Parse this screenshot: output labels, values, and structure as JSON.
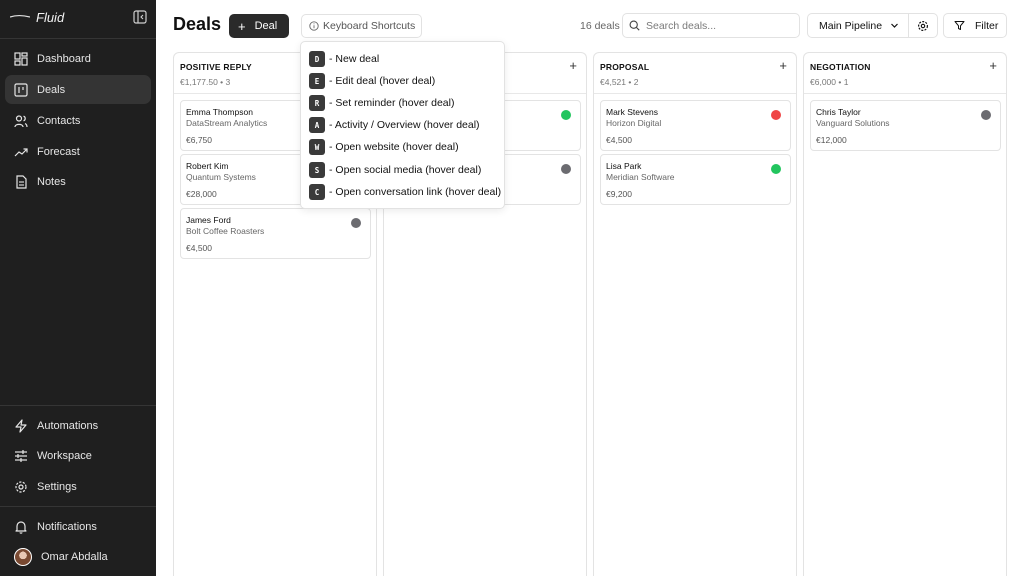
{
  "app": {
    "name": "Fluid"
  },
  "sidebar": {
    "nav": [
      {
        "label": "Dashboard",
        "icon": "dashboard-icon",
        "active": false
      },
      {
        "label": "Deals",
        "icon": "deals-icon",
        "active": true
      },
      {
        "label": "Contacts",
        "icon": "contacts-icon",
        "active": false
      },
      {
        "label": "Forecast",
        "icon": "trending-up-icon",
        "active": false
      },
      {
        "label": "Notes",
        "icon": "notes-icon",
        "active": false
      }
    ],
    "bottom_nav": [
      {
        "label": "Automations",
        "icon": "zap-icon"
      },
      {
        "label": "Workspace",
        "icon": "sliders-icon"
      },
      {
        "label": "Settings",
        "icon": "gear-icon"
      }
    ],
    "notifications": {
      "label": "Notifications",
      "icon": "bell-icon"
    },
    "user": {
      "name": "Omar Abdalla"
    }
  },
  "header": {
    "title": "Deals",
    "add_button_label": "Deal",
    "shortcuts_button_label": "Keyboard Shortcuts",
    "deal_count": "16 deals",
    "search_placeholder": "Search deals...",
    "pipeline": "Main Pipeline",
    "filter_label": "Filter"
  },
  "shortcuts": [
    {
      "key": "D",
      "label": "- New deal"
    },
    {
      "key": "E",
      "label": "- Edit deal (hover deal)"
    },
    {
      "key": "R",
      "label": "- Set reminder (hover deal)"
    },
    {
      "key": "A",
      "label": "- Activity / Overview (hover deal)"
    },
    {
      "key": "W",
      "label": "- Open website (hover deal)"
    },
    {
      "key": "S",
      "label": "- Open social media (hover deal)"
    },
    {
      "key": "C",
      "label": "- Open conversation link (hover deal)"
    }
  ],
  "columns": [
    {
      "title": "POSITIVE REPLY",
      "summary": "€1,177.50 • 3",
      "cards": [
        {
          "name": "Emma Thompson",
          "company": "DataStream Analytics",
          "value": "€6,750",
          "status_color": ""
        },
        {
          "name": "Robert Kim",
          "company": "Quantum Systems",
          "value": "€28,000",
          "status_color": ""
        },
        {
          "name": "James Ford",
          "company": "Bolt Coffee Roasters",
          "value": "€4,500",
          "status_color": "#6b6b70"
        }
      ]
    },
    {
      "title": "",
      "summary": "",
      "cards": [
        {
          "name": "",
          "company": "",
          "value": "",
          "status_color": "#22c55e"
        },
        {
          "name": "",
          "company": "",
          "value": "",
          "status_color": "#6b6b70"
        }
      ]
    },
    {
      "title": "PROPOSAL",
      "summary": "€4,521 • 2",
      "cards": [
        {
          "name": "Mark Stevens",
          "company": "Horizon Digital",
          "value": "€4,500",
          "status_color": "#ef4444"
        },
        {
          "name": "Lisa Park",
          "company": "Meridian Software",
          "value": "€9,200",
          "status_color": "#22c55e"
        }
      ]
    },
    {
      "title": "NEGOTIATION",
      "summary": "€6,000 • 1",
      "cards": [
        {
          "name": "Chris Taylor",
          "company": "Vanguard Solutions",
          "value": "€12,000",
          "status_color": "#6b6b70"
        }
      ]
    }
  ]
}
